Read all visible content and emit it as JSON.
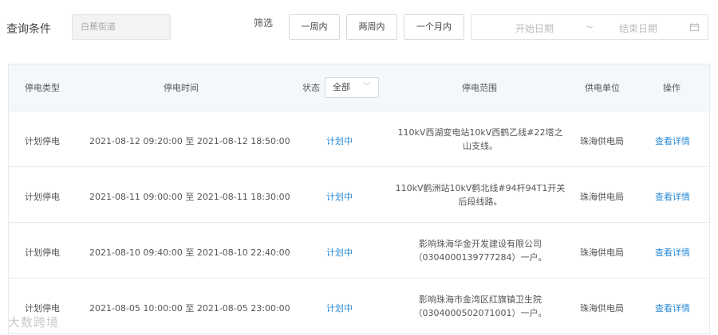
{
  "filters": {
    "query_label": "查询条件",
    "region_value": "白蕉街道",
    "filter_label": "筛选",
    "btn_one_week": "一周内",
    "btn_two_weeks": "两周内",
    "btn_one_month": "一个月内",
    "start_date_placeholder": "开始日期",
    "range_separator": "~",
    "end_date_placeholder": "结束日期"
  },
  "table": {
    "headers": {
      "type": "停电类型",
      "time": "停电时间",
      "status_label": "状态",
      "status_value": "全部",
      "range": "停电范围",
      "unit": "供电单位",
      "operation": "操作"
    },
    "rows": [
      {
        "type": "计划停电",
        "time": "2021-08-12 09:20:00 至 2021-08-12 18:50:00",
        "status": "计划中",
        "range_line1": "110kV西湖变电站10kV西鹤乙线#22塔之",
        "range_line2": "山支线。",
        "unit": "珠海供电局",
        "action": "查看详情"
      },
      {
        "type": "计划停电",
        "time": "2021-08-11 09:00:00 至 2021-08-11 18:30:00",
        "status": "计划中",
        "range_line1": "110kV鹤洲站10kV鹤北线#94杆94T1开关",
        "range_line2": "后段线路。",
        "unit": "珠海供电局",
        "action": "查看详情"
      },
      {
        "type": "计划停电",
        "time": "2021-08-10 09:40:00 至 2021-08-10 22:40:00",
        "status": "计划中",
        "range_line1": "影响珠海华金开发建设有限公司",
        "range_line2": "（0304000139777284）一户。",
        "unit": "珠海供电局",
        "action": "查看详情"
      },
      {
        "type": "计划停电",
        "time": "2021-08-05 10:00:00 至 2021-08-05 23:00:00",
        "status": "计划中",
        "range_line1": "影响珠海市金湾区红旗镇卫生院",
        "range_line2": "（0304000502071001）一户。",
        "unit": "珠海供电局",
        "action": "查看详情"
      }
    ]
  },
  "watermark": "大数跨境"
}
